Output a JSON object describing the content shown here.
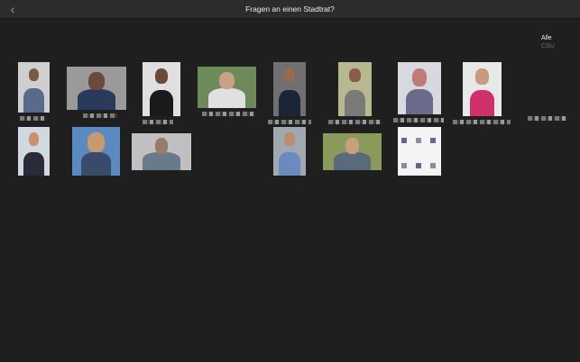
{
  "app": {
    "title": "Fragen an einen Stadtrat?",
    "back_icon": "chevron-left-icon"
  },
  "filter": {
    "options": [
      {
        "label": "Alle",
        "active": true
      },
      {
        "label": "CSU",
        "active": false
      }
    ]
  },
  "councillors": [
    {
      "id": 1,
      "photo_colors": [
        "#cfcfcf",
        "#7a5a45",
        "#5a6a8a"
      ]
    },
    {
      "id": 2,
      "photo_colors": [
        "#9a9a9a",
        "#6a4a3a",
        "#2a3a5a"
      ]
    },
    {
      "id": 3,
      "photo_colors": [
        "#e0e0e0",
        "#6a4a3a",
        "#1a1a1a"
      ]
    },
    {
      "id": 4,
      "photo_colors": [
        "#6f8a5a",
        "#c9a089",
        "#e0e0e0"
      ]
    },
    {
      "id": 5,
      "photo_colors": [
        "#707070",
        "#9a6a50",
        "#1c2535"
      ]
    },
    {
      "id": 6,
      "photo_colors": [
        "#b8b890",
        "#8a5a4a",
        "#7a7a7a"
      ]
    },
    {
      "id": 7,
      "photo_colors": [
        "#d8d8e0",
        "#c07a7a",
        "#6a6a8a"
      ]
    },
    {
      "id": 8,
      "photo_colors": [
        "#e8e8e8",
        "#c89a80",
        "#d0306a"
      ]
    },
    {
      "id": 9,
      "photo_colors": [
        "#2a2a2a",
        "#8a6a5a",
        "#1a1a22"
      ]
    },
    {
      "id": 10,
      "photo_colors": [
        "#d0d8e0",
        "#c89070",
        "#2a2a38"
      ]
    },
    {
      "id": 11,
      "photo_colors": [
        "#5a8ac0",
        "#c89a70",
        "#3a4a6a"
      ]
    },
    {
      "id": 12,
      "photo_colors": [
        "#c0c0c0",
        "#9a7a6a",
        "#6a7a8a"
      ]
    },
    {
      "id": 13,
      "photo_colors": [
        "#a0a8b0",
        "#c08a70",
        "#6a8ac0"
      ]
    },
    {
      "id": 14,
      "photo_colors": [
        "#8a9a5a",
        "#c8a080",
        "#5a6a7a"
      ]
    },
    {
      "id": 15,
      "photo_colors": [
        "#f4f4f4",
        "#e8e8e8",
        "#dcdcdc"
      ]
    }
  ]
}
